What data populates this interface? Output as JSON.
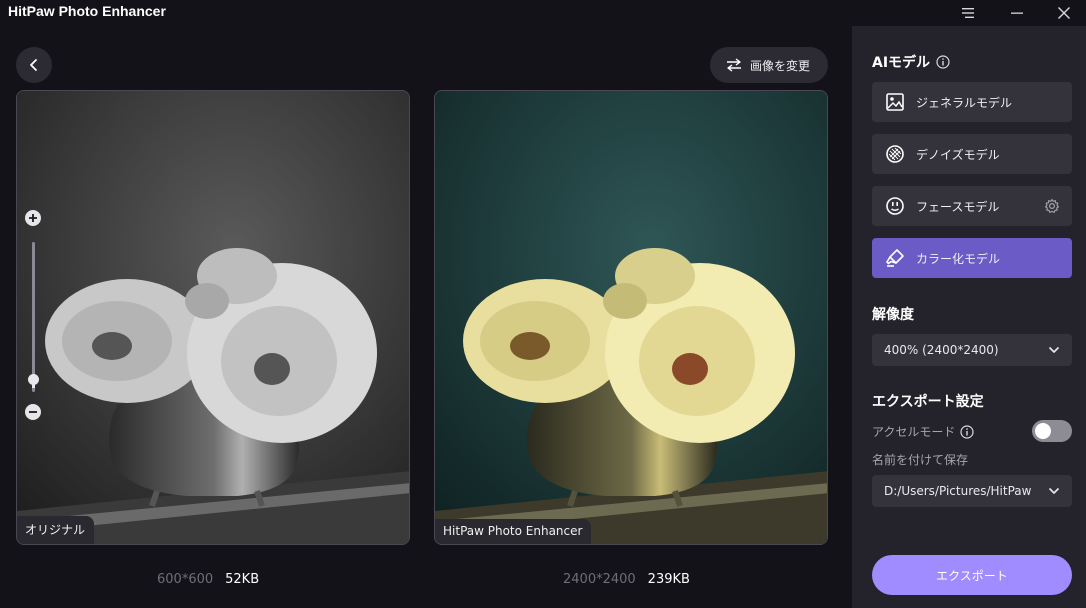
{
  "app": {
    "title": "HitPaw Photo Enhancer"
  },
  "toolbar": {
    "change_image_label": "画像を変更"
  },
  "preview": {
    "original_label": "オリジナル",
    "enhanced_label": "HitPaw Photo Enhancer",
    "original_dimensions": "600*600",
    "original_size": "52KB",
    "enhanced_dimensions": "2400*2400",
    "enhanced_size": "239KB"
  },
  "sidebar": {
    "ai_model_heading": "AIモデル",
    "models": [
      {
        "label": "ジェネラルモデル",
        "icon": "image-icon",
        "active": false
      },
      {
        "label": "デノイズモデル",
        "icon": "denoise-icon",
        "active": false
      },
      {
        "label": "フェースモデル",
        "icon": "face-icon",
        "active": false
      },
      {
        "label": "カラー化モデル",
        "icon": "brush-icon",
        "active": true
      }
    ],
    "resolution_heading": "解像度",
    "resolution_value": "400% (2400*2400)",
    "export_settings_heading": "エクスポート設定",
    "accel_mode_label": "アクセルモード",
    "accel_mode_on": false,
    "save_as_label": "名前を付けて保存",
    "save_path": "D:/Users/Pictures/HitPaw",
    "export_button": "エクスポート"
  },
  "colors": {
    "accent_active": "#6a5bc7",
    "export_button": "#a18cff",
    "sidebar_bg": "#24232c",
    "main_bg": "#131219"
  }
}
